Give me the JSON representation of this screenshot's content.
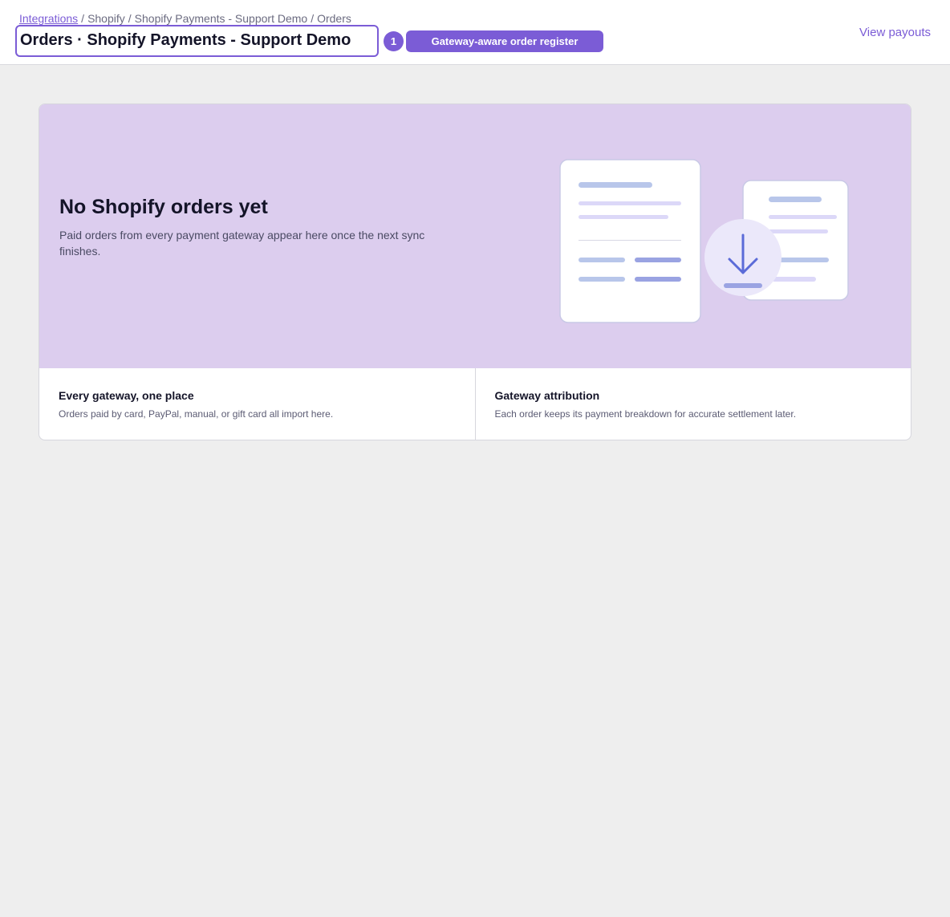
{
  "header": {
    "breadcrumb": {
      "link": "Integrations",
      "rest": [
        "Shopify",
        "Shopify Payments - Support Demo",
        "Orders"
      ],
      "separator": "/"
    },
    "title": "Orders · Shopify Payments - Support Demo",
    "step_number": "1",
    "step_label": "Gateway-aware order register",
    "action_link": "View payouts"
  },
  "empty_state": {
    "heading": "No Shopify orders yet",
    "description": "Paid orders from every payment gateway appear here once the next sync finishes.",
    "illustration": "documents-download-icon"
  },
  "features": [
    {
      "title": "Every gateway, one place",
      "description": "Orders paid by card, PayPal, manual, or gift card all import here."
    },
    {
      "title": "Gateway attribution",
      "description": "Each order keeps its payment breakdown for accurate settlement later."
    }
  ],
  "colors": {
    "accent": "#7b5cd6",
    "hero_background": "#dccdee",
    "page_background": "#eeeeee"
  }
}
